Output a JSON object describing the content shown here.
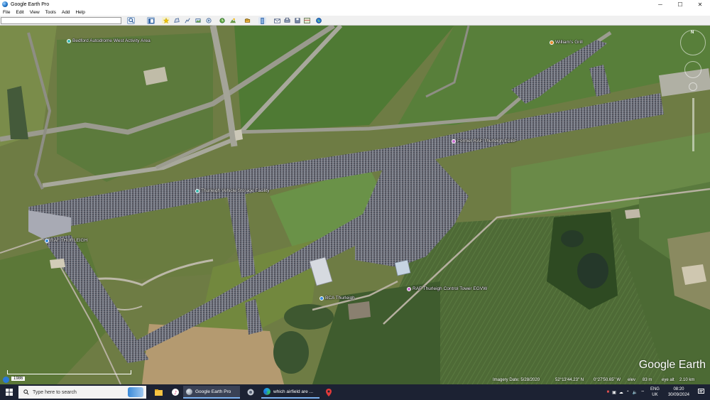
{
  "window": {
    "title": "Google Earth Pro",
    "minimize": "─",
    "maximize": "☐",
    "close": "✕"
  },
  "menu": [
    "File",
    "Edit",
    "View",
    "Tools",
    "Add",
    "Help"
  ],
  "search": {
    "value": "",
    "placeholder": ""
  },
  "toolbar_icons": [
    "search-icon",
    "sidebar-toggle-icon",
    "placemark-icon",
    "polygon-icon",
    "path-icon",
    "image-overlay-icon",
    "tour-icon",
    "historical-imagery-icon",
    "sunlight-icon",
    "planets-icon",
    "ruler-icon",
    "email-icon",
    "print-icon",
    "save-image-icon",
    "maps-icon",
    "globe-icon"
  ],
  "places": [
    {
      "label": "Bedford Autodrome West Activity Area",
      "color": "#3bb8b0"
    },
    {
      "label": "William's Grill",
      "color": "#e88a2c"
    },
    {
      "label": "Former RAF Thurleigh EGBF",
      "color": "#c86ad0"
    },
    {
      "label": "Thurleigh Vehicle Storage Facility",
      "color": "#3bb8b0"
    },
    {
      "label": "RAF THURLEIGH",
      "color": "#3b8de0"
    },
    {
      "label": "RAF Thurleigh Control Tower EGVW",
      "color": "#c86ad0"
    },
    {
      "label": "BCA Thurleigh",
      "color": "#3b8de0"
    }
  ],
  "map_footer": {
    "imagery_date": "Imagery Date: 5/28/2020",
    "lat": "52°13'44.23\" N",
    "lon": "0°27'50.65\" W",
    "elev": "elev",
    "elev_value": "83 m",
    "eye_alt": "eye alt",
    "eye_alt_value": "2.10 km",
    "scale": "1986",
    "scale_label": "1 km",
    "brand": "Google Earth"
  },
  "taskbar": {
    "search_placeholder": "Type here to search",
    "apps": [
      {
        "label": "Google Earth Pro"
      },
      {
        "label": "which airfield are ..."
      }
    ],
    "lang1": "ENG",
    "lang2": "UK",
    "time": "08:20",
    "date": "30/09/2024"
  }
}
